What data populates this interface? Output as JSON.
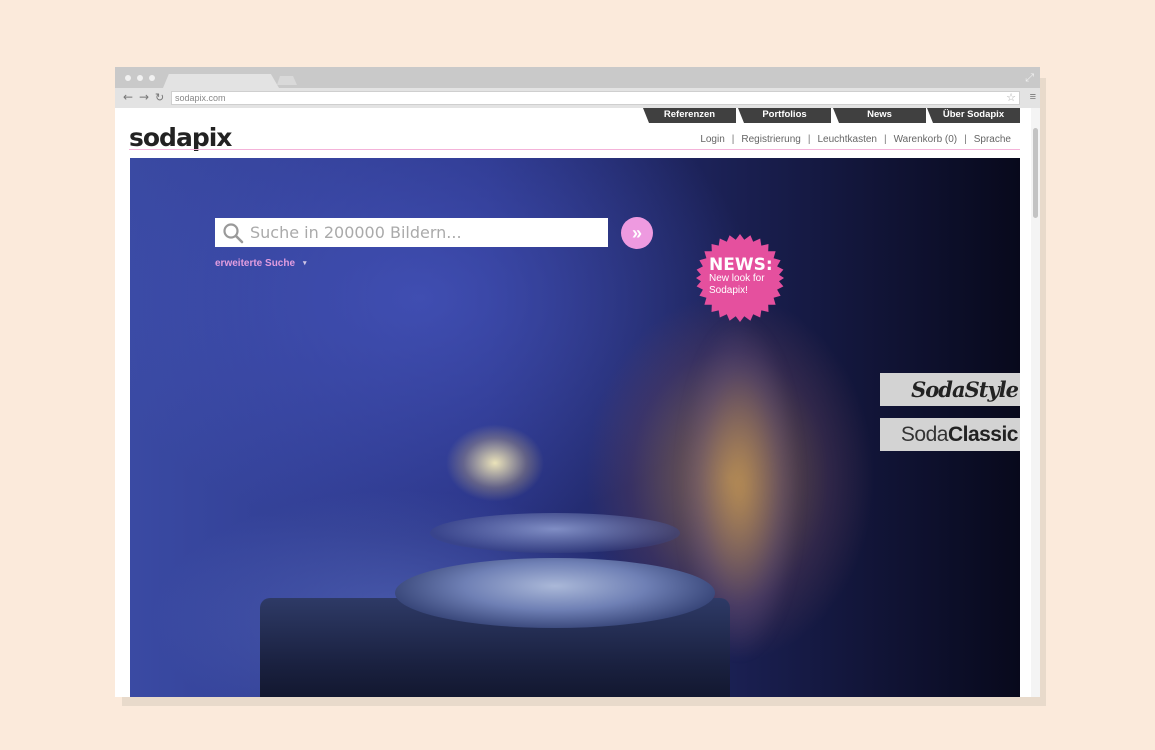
{
  "browser": {
    "url": "sodapix.com",
    "icons": {
      "back": "arrow-left-icon",
      "forward": "arrow-right-icon",
      "reload": "reload-icon",
      "bookmark": "star-icon",
      "menu": "hamburger-menu-icon",
      "fullscreen": "expand-icon"
    }
  },
  "site": {
    "logo": "sodapix",
    "top_nav": [
      {
        "label": "Referenzen"
      },
      {
        "label": "Portfolios"
      },
      {
        "label": "News"
      },
      {
        "label": "Über Sodapix"
      }
    ],
    "utility_links": {
      "login": "Login",
      "register": "Registrierung",
      "lightbox": "Leuchtkasten",
      "cart": "Warenkorb (0)",
      "language": "Sprache",
      "separator": "|"
    },
    "search": {
      "placeholder": "Suche in 200000 Bildern...",
      "go_label": "»",
      "advanced_label": "erweiterte Suche",
      "advanced_caret": "▾"
    },
    "news_badge": {
      "title": "NEWS:",
      "text_line1": "New look for",
      "text_line2": "Sodapix!"
    },
    "style_buttons": {
      "soda_style": "SodaStyle",
      "classic_prefix": "Soda",
      "classic_suffix": "Classic"
    }
  },
  "colors": {
    "background": "#fbeadb",
    "nav_tab": "#404040",
    "accent_pink": "#e5509e",
    "link_pink": "#e29ddf",
    "go_button": "#ee9ae0",
    "style_button": "#d3d3d3"
  }
}
